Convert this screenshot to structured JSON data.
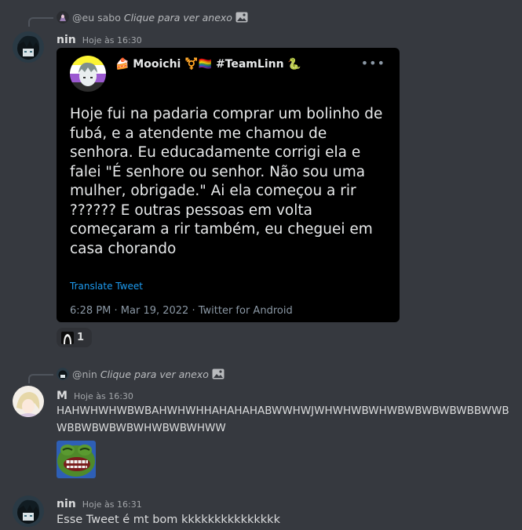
{
  "messages": [
    {
      "reply": {
        "user": "@eu sabo",
        "content": "Clique para ver anexo"
      },
      "username": "nin",
      "timestamp": "Hoje às 16:30",
      "tweet": {
        "author": "🍰 Mooichi ⚧️🏳️‍🌈 #TeamLinn 🐍",
        "text": "Hoje fui na padaria comprar um bolinho de fubá, e a atendente me chamou de senhora. Eu educadamente corrigi ela e falei \"É senhore ou senhor. Não sou uma mulher, obrigade.\" Ai ela começou a rir ?????? E outras pessoas em volta começaram a rir também, eu cheguei em casa chorando",
        "translate": "Translate Tweet",
        "meta": "6:28 PM · Mar 19, 2022 · Twitter for Android"
      },
      "reaction_count": "1"
    },
    {
      "reply": {
        "user": "@nin",
        "content": "Clique para ver anexo"
      },
      "username": "M",
      "timestamp": "Hoje às 16:30",
      "text": "HAHWHWHWBWBAHWHWHHAHAHAHABWWHWJWHWHWBWHWBWBWBWBWBBWWBWBBWBWBWBWHWBWBWHWW",
      "sticker": "laughing-frog-emoji"
    },
    {
      "username": "nin",
      "timestamp": "Hoje às 16:31",
      "text": "Esse Tweet é mt bom kkkkkkkkkkkkkkk"
    }
  ],
  "colors": {
    "background": "#36393f",
    "tweet_bg": "#000000",
    "link": "#1d9bf0"
  }
}
